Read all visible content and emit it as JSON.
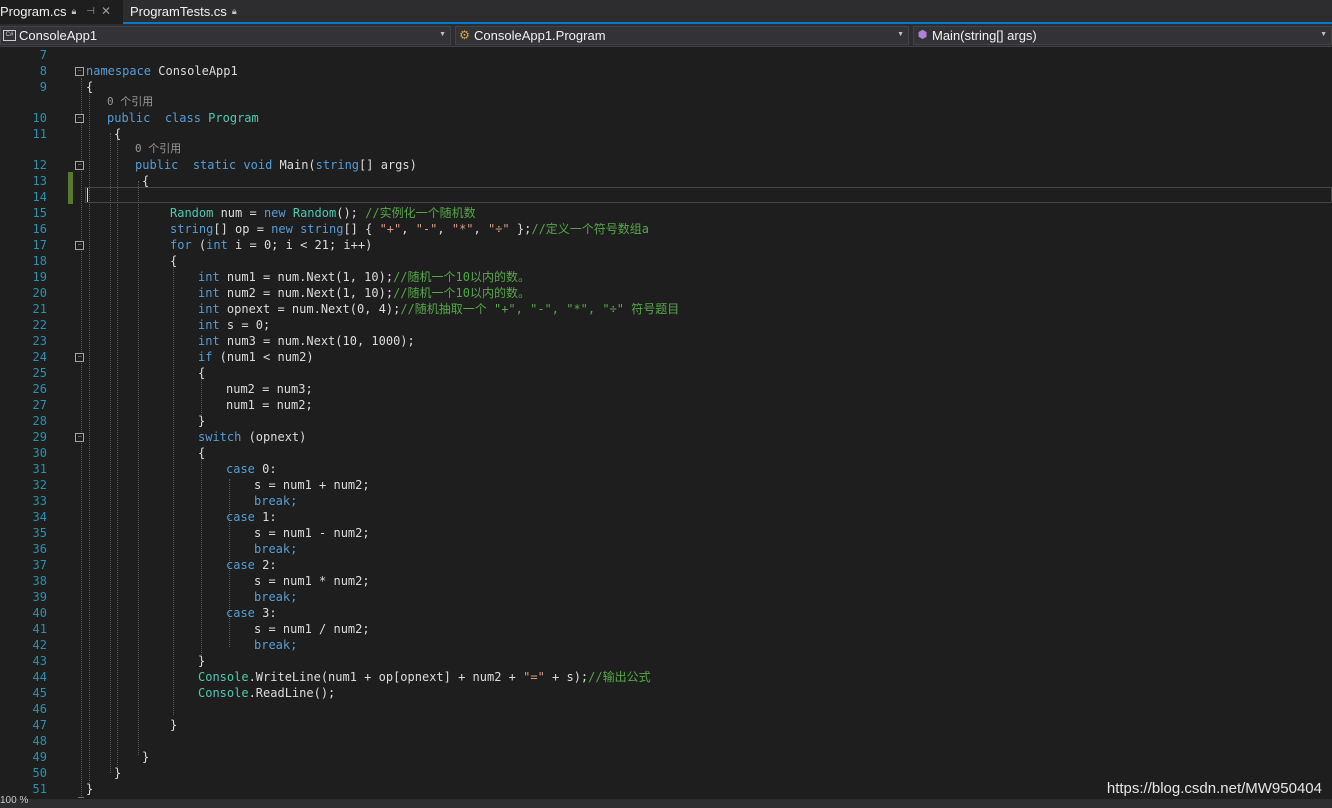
{
  "tabs": [
    {
      "label": "Program.cs",
      "active": true
    },
    {
      "label": "ProgramTests.cs",
      "active": false
    }
  ],
  "navbar": {
    "project": "ConsoleApp1",
    "type": "ConsoleApp1.Program",
    "member": "Main(string[] args)"
  },
  "editor": {
    "line_numbers": [
      "7",
      "8",
      "9",
      "10",
      "11",
      "12",
      "13",
      "14",
      "15",
      "16",
      "17",
      "18",
      "19",
      "20",
      "21",
      "22",
      "23",
      "24",
      "25",
      "26",
      "27",
      "28",
      "29",
      "30",
      "31",
      "32",
      "33",
      "34",
      "35",
      "36",
      "37",
      "38",
      "39",
      "40",
      "41",
      "42",
      "43",
      "44",
      "45",
      "46",
      "47",
      "48",
      "49",
      "50",
      "51"
    ],
    "codelens_class": "0 个引用",
    "codelens_method": "0 个引用",
    "code": {
      "ns_kw": "namespace",
      "ns_name": " ConsoleApp1",
      "brace_open": "{",
      "brace_close": "}",
      "public": "public",
      "class_kw": "class",
      "class_name": "Program",
      "static": "static",
      "void": "void",
      "main_sig": " Main(",
      "string_kw": "string",
      "args": "[] args)",
      "l15_ty": "Random",
      "l15_a": " num = ",
      "new": "new",
      "l15_b": "(); ",
      "l15_c": "//实例化一个随机数",
      "l16_a": "[] op = ",
      "l16_b": "[] { ",
      "s_plus": "\"+\"",
      "s_minus": "\"-\"",
      "s_mul": "\"*\"",
      "s_div": "\"÷\"",
      "comma": ", ",
      "l16_c": " };",
      "l16_cm": "//定义一个符号数组a",
      "for": "for",
      "l17_a": " (",
      "int": "int",
      "l17_b": " i = 0; i < 21; i++)",
      "l19_a": " num1 = num.Next(1, 10);",
      "l19_cm": "//随机一个10以内的数。",
      "l20_a": " num2 = num.Next(1, 10);",
      "l20_cm": "//随机一个10以内的数。",
      "l21_a": " opnext = num.Next(0, 4);",
      "l21_cm": "//随机抽取一个 \"+\", \"-\", \"*\", \"÷\" 符号题目",
      "l22_a": " s = 0;",
      "l23_a": " num3 = num.Next(10, 1000);",
      "if": "if",
      "l24_a": " (num1 < num2)",
      "l26": "num2 = num3;",
      "l27": "num1 = num2;",
      "switch": "switch",
      "l29_a": " (opnext)",
      "case": "case",
      "c0": " 0:",
      "c1": " 1:",
      "c2": " 2:",
      "c3": " 3:",
      "l32": "s = num1 + num2;",
      "l35": "s = num1 - num2;",
      "l38": "s = num1 * num2;",
      "l41": "s = num1 / num2;",
      "break": "break;",
      "console": "Console",
      "l44_a": ".WriteLine(num1 + op[opnext] + num2 + ",
      "s_eq": "\"=\"",
      "l44_b": " + s);",
      "l44_cm": "//输出公式",
      "l45_a": ".ReadLine();"
    }
  },
  "status": {
    "zoom": "100 %"
  },
  "watermark": "https://blog.csdn.net/MW950404"
}
